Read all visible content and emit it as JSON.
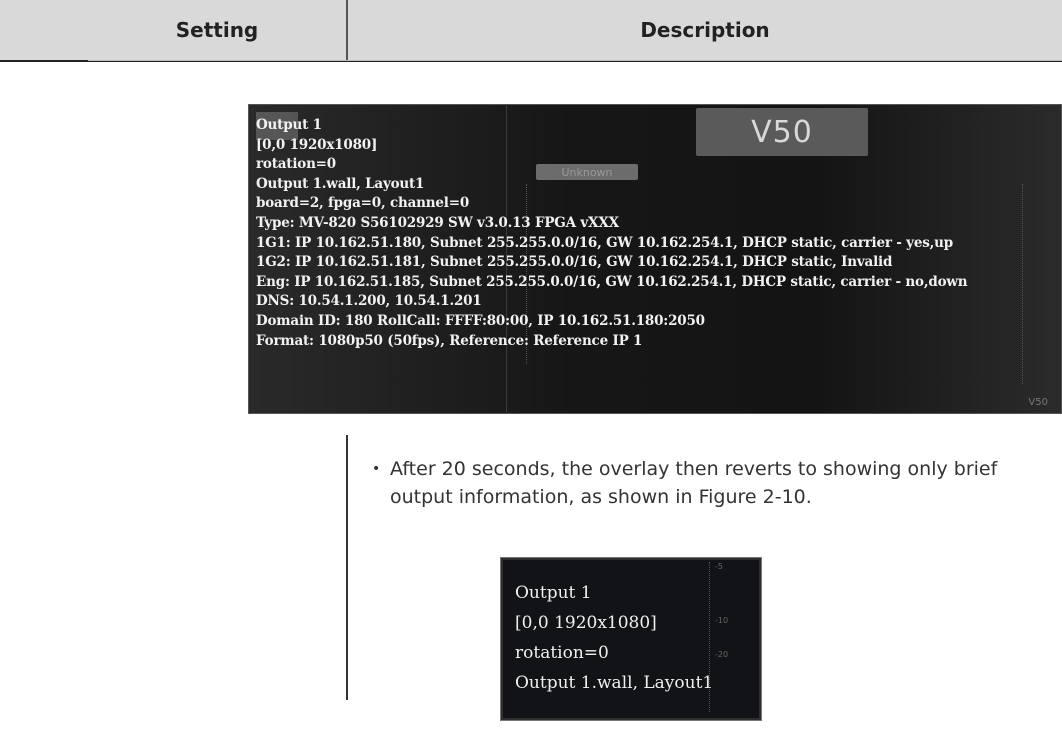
{
  "table": {
    "header_setting": "Setting",
    "header_description": "Description"
  },
  "overlay_full": {
    "title_badge": "V50",
    "status_tag": "Unknown",
    "corner_label": "V50",
    "lines": [
      "Output 1",
      "[0,0 1920x1080]",
      "rotation=0",
      "Output 1.wall, Layout1",
      "board=2, fpga=0, channel=0",
      "Type: MV-820 S56102929 SW v3.0.13 FPGA vXXX",
      "1G1: IP 10.162.51.180, Subnet 255.255.0.0/16, GW 10.162.254.1, DHCP static, carrier - yes,up",
      "1G2: IP 10.162.51.181, Subnet 255.255.0.0/16, GW 10.162.254.1, DHCP static, Invalid",
      "Eng: IP 10.162.51.185, Subnet 255.255.0.0/16, GW 10.162.254.1, DHCP static, carrier - no,down",
      "DNS: 10.54.1.200, 10.54.1.201",
      "Domain ID: 180 RollCall: FFFF:80:00, IP 10.162.51.180:2050",
      "Format: 1080p50 (50fps), Reference: Reference IP 1"
    ]
  },
  "bullet": {
    "marker": "•",
    "text": "After 20 seconds, the overlay then reverts to showing only brief output information, as shown in Figure 2-10."
  },
  "overlay_brief": {
    "lines": [
      "Output 1",
      "[0,0 1920x1080]",
      "rotation=0",
      "Output 1.wall, Layout1"
    ],
    "meter_labels": [
      "-5",
      "-10",
      "-20"
    ]
  }
}
